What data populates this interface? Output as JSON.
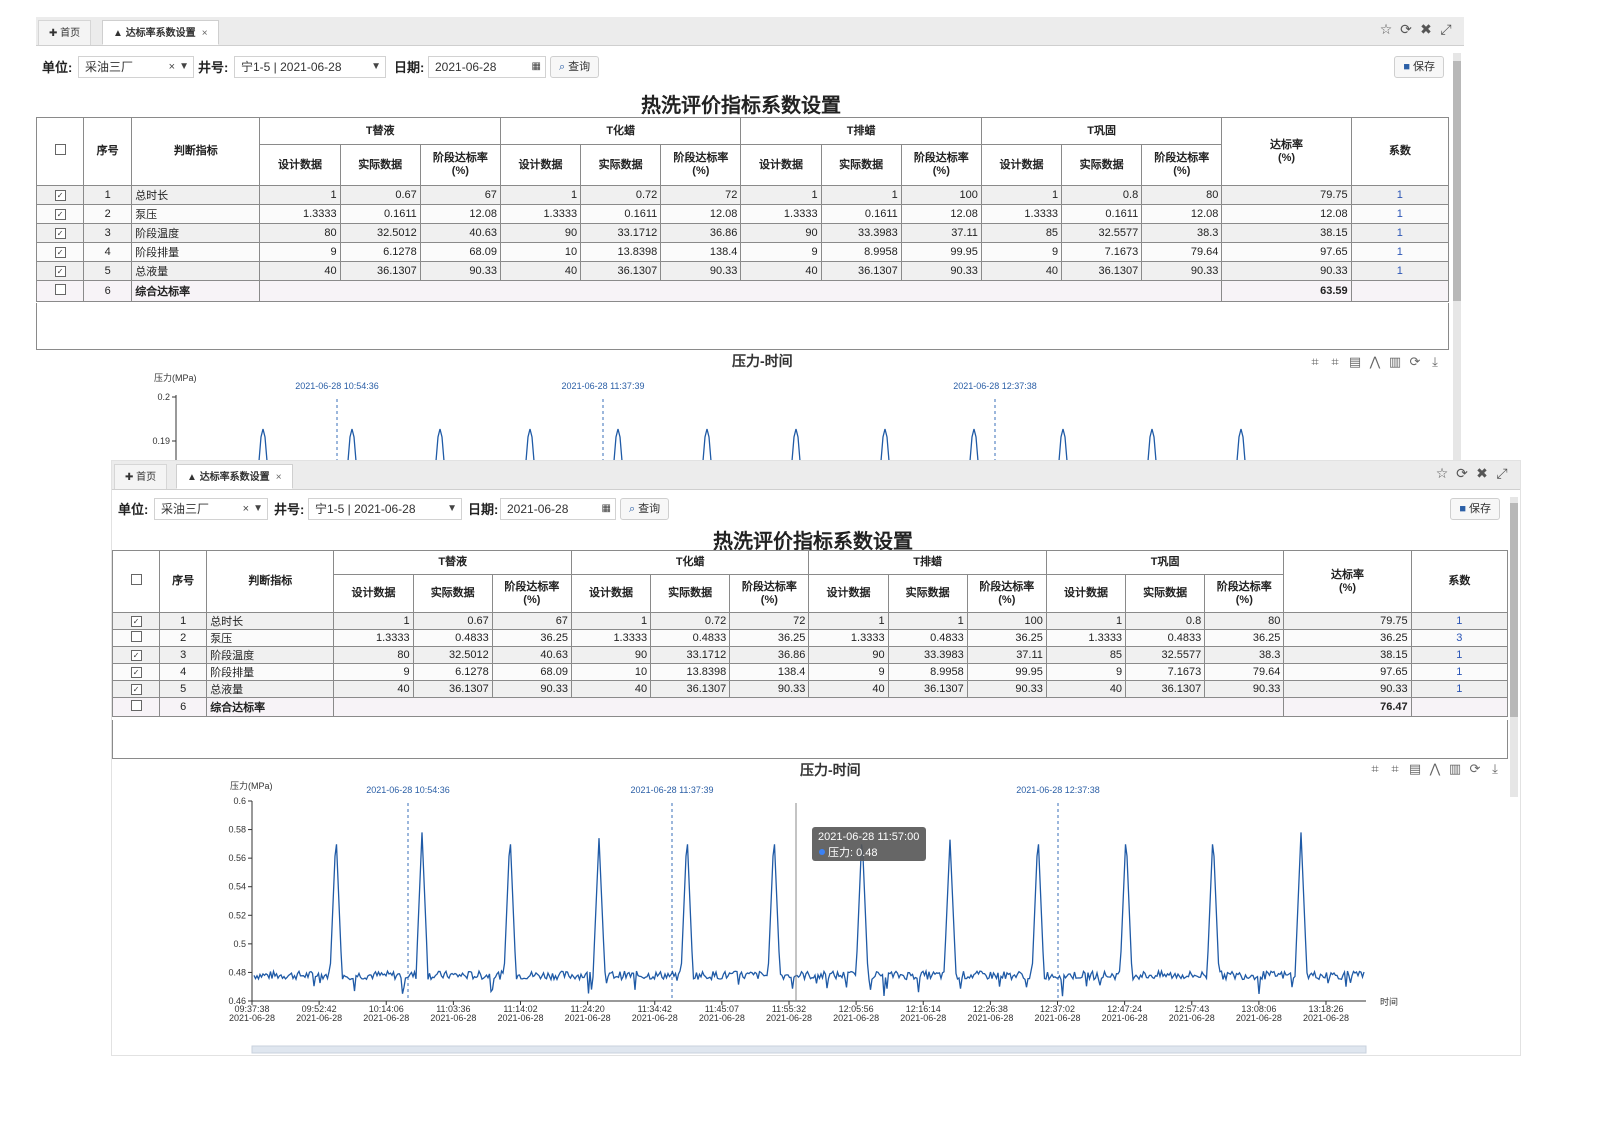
{
  "tabs": {
    "home": "首页",
    "active": "达标率系数设置",
    "close": "×"
  },
  "window_icons": [
    "star-icon",
    "refresh-icon",
    "close-icon",
    "fullscreen-icon"
  ],
  "toolbar": {
    "unit_label": "单位:",
    "unit_value": "采油三厂",
    "well_label": "井号:",
    "well_value": "宁1-5 | 2021-06-28",
    "date_label": "日期:",
    "date_value": "2021-06-28",
    "query_label": "查询",
    "save_label": "保存"
  },
  "page_title": "热洗评价指标系数设置",
  "table": {
    "headers": {
      "index": "序号",
      "indicator": "判断指标",
      "groups": [
        "T替液",
        "T化蜡",
        "T排蜡",
        "T巩固"
      ],
      "sub": [
        "设计数据",
        "实际数据",
        "阶段达标率\n(%)"
      ],
      "rate": "达标率\n(%)",
      "coef": "系数"
    }
  },
  "panels": [
    {
      "rows": [
        {
          "checked": true,
          "idx": "1",
          "name": "总时长",
          "vals": [
            "1",
            "0.67",
            "67",
            "1",
            "0.72",
            "72",
            "1",
            "1",
            "100",
            "1",
            "0.8",
            "80"
          ],
          "rate": "79.75",
          "coef": "1"
        },
        {
          "checked": true,
          "idx": "2",
          "name": "泵压",
          "vals": [
            "1.3333",
            "0.1611",
            "12.08",
            "1.3333",
            "0.1611",
            "12.08",
            "1.3333",
            "0.1611",
            "12.08",
            "1.3333",
            "0.1611",
            "12.08"
          ],
          "rate": "12.08",
          "coef": "1"
        },
        {
          "checked": true,
          "idx": "3",
          "name": "阶段温度",
          "vals": [
            "80",
            "32.5012",
            "40.63",
            "90",
            "33.1712",
            "36.86",
            "90",
            "33.3983",
            "37.11",
            "85",
            "32.5577",
            "38.3"
          ],
          "rate": "38.15",
          "coef": "1"
        },
        {
          "checked": true,
          "idx": "4",
          "name": "阶段排量",
          "vals": [
            "9",
            "6.1278",
            "68.09",
            "10",
            "13.8398",
            "138.4",
            "9",
            "8.9958",
            "99.95",
            "9",
            "7.1673",
            "79.64"
          ],
          "rate": "97.65",
          "coef": "1"
        },
        {
          "checked": true,
          "idx": "5",
          "name": "总液量",
          "vals": [
            "40",
            "36.1307",
            "90.33",
            "40",
            "36.1307",
            "90.33",
            "40",
            "36.1307",
            "90.33",
            "40",
            "36.1307",
            "90.33"
          ],
          "rate": "90.33",
          "coef": "1"
        }
      ],
      "summary": {
        "idx": "6",
        "name": "综合达标率",
        "value": "63.59"
      }
    },
    {
      "rows": [
        {
          "checked": true,
          "idx": "1",
          "name": "总时长",
          "vals": [
            "1",
            "0.67",
            "67",
            "1",
            "0.72",
            "72",
            "1",
            "1",
            "100",
            "1",
            "0.8",
            "80"
          ],
          "rate": "79.75",
          "coef": "1"
        },
        {
          "checked": false,
          "idx": "2",
          "name": "泵压",
          "vals": [
            "1.3333",
            "0.4833",
            "36.25",
            "1.3333",
            "0.4833",
            "36.25",
            "1.3333",
            "0.4833",
            "36.25",
            "1.3333",
            "0.4833",
            "36.25"
          ],
          "rate": "36.25",
          "coef": "3"
        },
        {
          "checked": true,
          "idx": "3",
          "name": "阶段温度",
          "vals": [
            "80",
            "32.5012",
            "40.63",
            "90",
            "33.1712",
            "36.86",
            "90",
            "33.3983",
            "37.11",
            "85",
            "32.5577",
            "38.3"
          ],
          "rate": "38.15",
          "coef": "1"
        },
        {
          "checked": true,
          "idx": "4",
          "name": "阶段排量",
          "vals": [
            "9",
            "6.1278",
            "68.09",
            "10",
            "13.8398",
            "138.4",
            "9",
            "8.9958",
            "99.95",
            "9",
            "7.1673",
            "79.64"
          ],
          "rate": "97.65",
          "coef": "1"
        },
        {
          "checked": true,
          "idx": "5",
          "name": "总液量",
          "vals": [
            "40",
            "36.1307",
            "90.33",
            "40",
            "36.1307",
            "90.33",
            "40",
            "36.1307",
            "90.33",
            "40",
            "36.1307",
            "90.33"
          ],
          "rate": "90.33",
          "coef": "1"
        }
      ],
      "summary": {
        "idx": "6",
        "name": "综合达标率",
        "value": "76.47"
      }
    }
  ],
  "chart_title": "压力-时间",
  "chart_tools": [
    "crop-icon",
    "crop-reset-icon",
    "data-view-icon",
    "line-chart-icon",
    "bar-chart-icon",
    "restore-icon",
    "download-icon"
  ],
  "chart_data": {
    "type": "line",
    "title": "压力-时间",
    "ylabel": "压力(MPa)",
    "xlabel": "时间",
    "ylim": [
      0.46,
      0.6
    ],
    "yticks": [
      "0.6",
      "0.58",
      "0.56",
      "0.54",
      "0.52",
      "0.5",
      "0.48",
      "0.46"
    ],
    "xticks": [
      [
        "09:37:38",
        "2021-06-28"
      ],
      [
        "09:52:42",
        "2021-06-28"
      ],
      [
        "10:14:06",
        "2021-06-28"
      ],
      [
        "11:03:36",
        "2021-06-28"
      ],
      [
        "11:14:02",
        "2021-06-28"
      ],
      [
        "11:24:20",
        "2021-06-28"
      ],
      [
        "11:34:42",
        "2021-06-28"
      ],
      [
        "11:45:07",
        "2021-06-28"
      ],
      [
        "11:55:32",
        "2021-06-28"
      ],
      [
        "12:05:56",
        "2021-06-28"
      ],
      [
        "12:16:14",
        "2021-06-28"
      ],
      [
        "12:26:38",
        "2021-06-28"
      ],
      [
        "12:37:02",
        "2021-06-28"
      ],
      [
        "12:47:24",
        "2021-06-28"
      ],
      [
        "12:57:43",
        "2021-06-28"
      ],
      [
        "13:08:06",
        "2021-06-28"
      ],
      [
        "13:18:26",
        "2021-06-28"
      ]
    ],
    "markers": [
      "2021-06-28 10:54:36",
      "2021-06-28 11:37:39",
      "2021-06-28 12:37:38"
    ],
    "baseline": 0.478,
    "peaks": [
      0.578,
      0.578,
      0.578,
      0.574,
      0.578,
      0.578,
      0.578,
      0.573,
      0.578,
      0.578,
      0.578,
      0.578,
      0.578
    ],
    "tooltip": {
      "time": "2021-06-28 11:57:00",
      "series": "压力",
      "value": "0.48"
    },
    "top_panel_yticks": [
      "0.2",
      "0.19"
    ],
    "color": "#1f5aa6"
  }
}
